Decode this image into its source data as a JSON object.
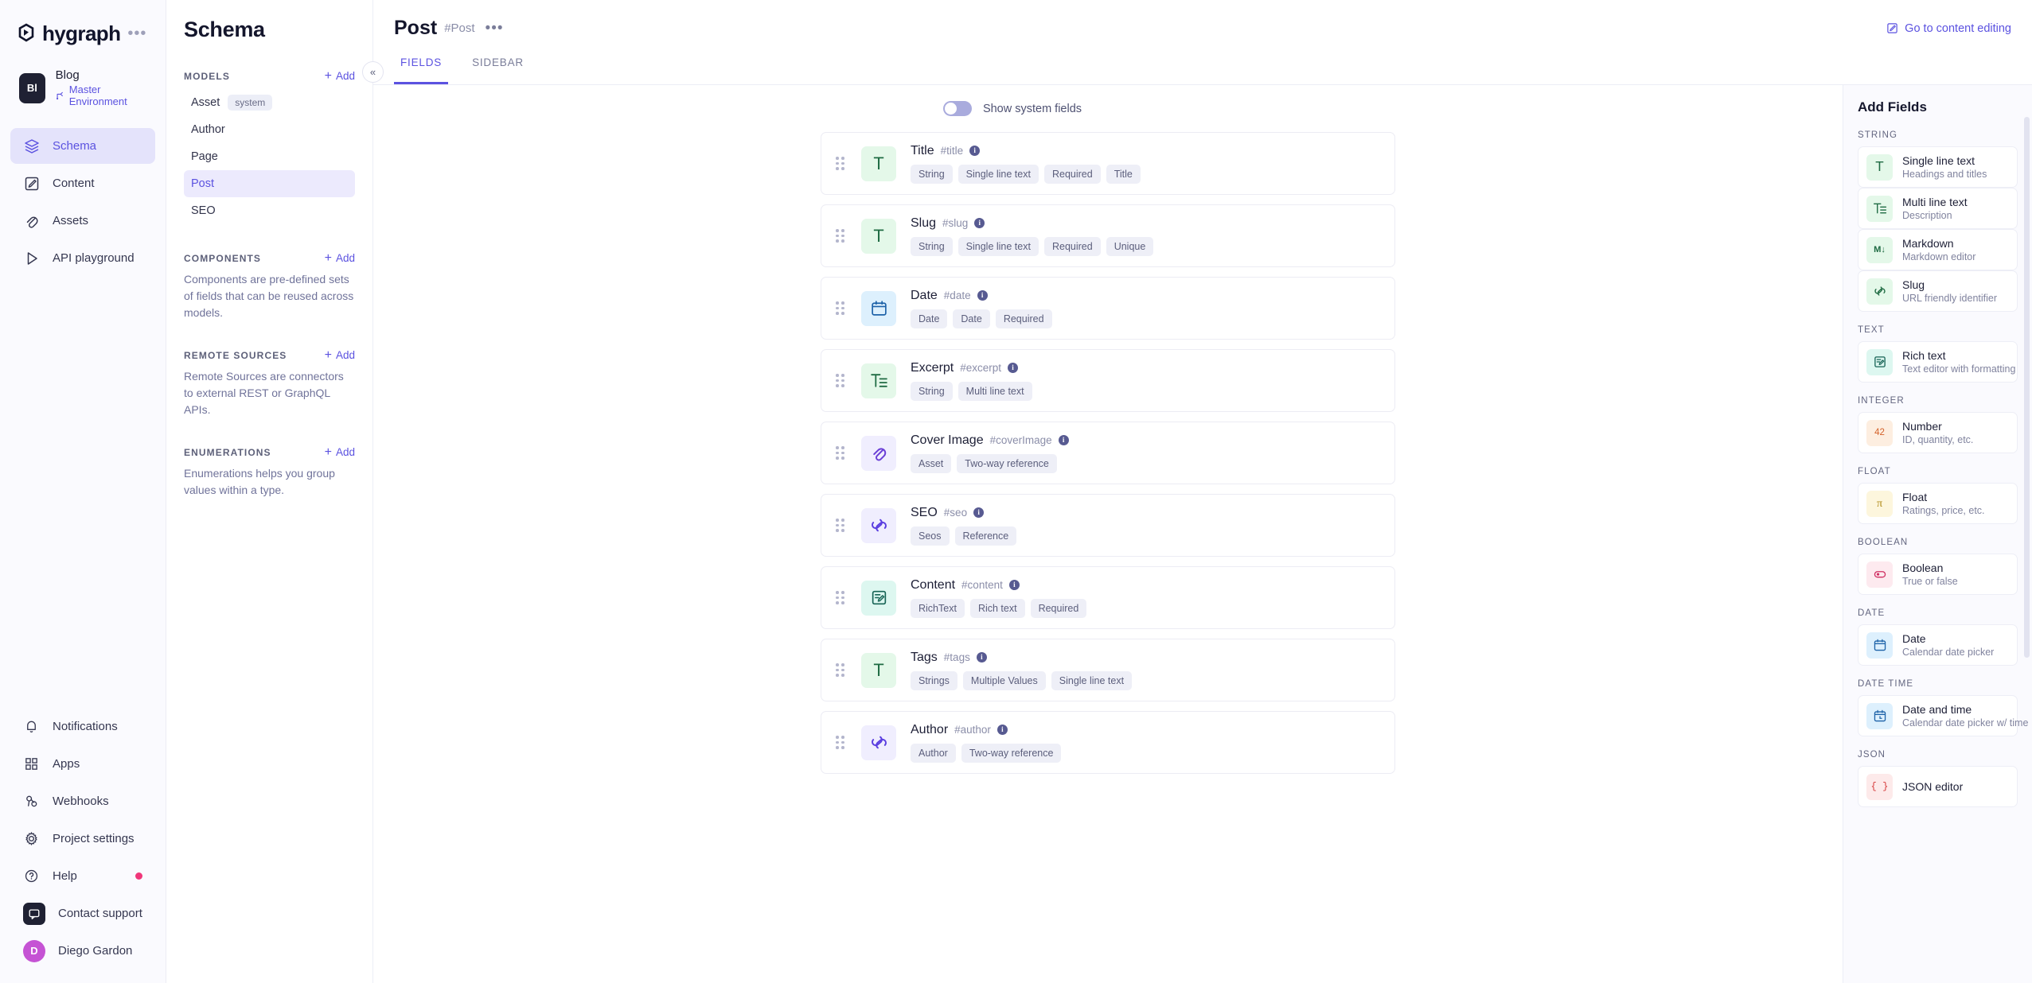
{
  "rail": {
    "brand": {
      "word": "hygraph",
      "dots": "•••",
      "logo_icon": "hygraph-logo-icon"
    },
    "project": {
      "badge": "Bl",
      "name": "Blog",
      "environment": "Master Environment"
    },
    "nav_primary": [
      {
        "label": "Schema",
        "icon": "layers-icon",
        "active": true
      },
      {
        "label": "Content",
        "icon": "edit-square-icon",
        "active": false
      },
      {
        "label": "Assets",
        "icon": "paperclip-icon",
        "active": false
      },
      {
        "label": "API playground",
        "icon": "play-icon",
        "active": false
      }
    ],
    "nav_secondary": [
      {
        "label": "Notifications",
        "icon": "bell-icon",
        "badge": false
      },
      {
        "label": "Apps",
        "icon": "grid-icon",
        "badge": false
      },
      {
        "label": "Webhooks",
        "icon": "webhook-icon",
        "badge": false
      },
      {
        "label": "Project settings",
        "icon": "gear-icon",
        "badge": false
      },
      {
        "label": "Help",
        "icon": "question-circle-icon",
        "badge": true
      }
    ],
    "support": {
      "label": "Contact support",
      "icon": "chat-icon"
    },
    "user": {
      "label": "Diego Gardon",
      "initial": "D"
    }
  },
  "schema_panel": {
    "title": "Schema",
    "collapse_icon": "chevron-double-left-icon",
    "sections": [
      {
        "label": "MODELS",
        "add_label": "Add",
        "items": [
          {
            "label": "Asset",
            "tag": "system",
            "active": false
          },
          {
            "label": "Author",
            "tag": "",
            "active": false
          },
          {
            "label": "Page",
            "tag": "",
            "active": false
          },
          {
            "label": "Post",
            "tag": "",
            "active": true
          },
          {
            "label": "SEO",
            "tag": "",
            "active": false
          }
        ],
        "description": ""
      },
      {
        "label": "COMPONENTS",
        "add_label": "Add",
        "items": [],
        "description": "Components are pre-defined sets of fields that can be reused across models."
      },
      {
        "label": "REMOTE SOURCES",
        "add_label": "Add",
        "items": [],
        "description": "Remote Sources are connectors to external REST or GraphQL APIs."
      },
      {
        "label": "ENUMERATIONS",
        "add_label": "Add",
        "items": [],
        "description": "Enumerations helps you group values within a type."
      }
    ]
  },
  "main": {
    "title": "Post",
    "api_id": "#Post",
    "dots": "•••",
    "goto_content_editing": "Go to content editing",
    "goto_icon": "edit-square-icon",
    "tabs": [
      {
        "label": "FIELDS",
        "active": true
      },
      {
        "label": "SIDEBAR",
        "active": false
      }
    ],
    "show_system_fields": {
      "label": "Show system fields",
      "enabled": false
    }
  },
  "fields": [
    {
      "name": "Title",
      "api_id": "#title",
      "icon": "single-line-text-icon",
      "icon_glyph": "T",
      "icon_bg": "#e4f8e9",
      "icon_fg": "#1f6b43",
      "chips": [
        "String",
        "Single line text",
        "Required",
        "Title"
      ]
    },
    {
      "name": "Slug",
      "api_id": "#slug",
      "icon": "single-line-text-icon",
      "icon_glyph": "T",
      "icon_bg": "#e4f8e9",
      "icon_fg": "#1f6b43",
      "chips": [
        "String",
        "Single line text",
        "Required",
        "Unique"
      ]
    },
    {
      "name": "Date",
      "api_id": "#date",
      "icon": "calendar-icon",
      "icon_glyph": "calendar",
      "icon_bg": "#ddf0fd",
      "icon_fg": "#1d62a8",
      "chips": [
        "Date",
        "Date",
        "Required"
      ]
    },
    {
      "name": "Excerpt",
      "api_id": "#excerpt",
      "icon": "multi-line-text-icon",
      "icon_glyph": "multiline",
      "icon_bg": "#e4f8e9",
      "icon_fg": "#1f6b43",
      "chips": [
        "String",
        "Multi line text"
      ]
    },
    {
      "name": "Cover Image",
      "api_id": "#coverImage",
      "icon": "paperclip-icon",
      "icon_glyph": "paperclip",
      "icon_bg": "#f0eefe",
      "icon_fg": "#6a3fd6",
      "chips": [
        "Asset",
        "Two-way reference"
      ]
    },
    {
      "name": "SEO",
      "api_id": "#seo",
      "icon": "reference-link-icon",
      "icon_glyph": "reference",
      "icon_bg": "#f0eefe",
      "icon_fg": "#5b3fe0",
      "chips": [
        "Seos",
        "Reference"
      ]
    },
    {
      "name": "Content",
      "api_id": "#content",
      "icon": "rich-text-icon",
      "icon_glyph": "richtext",
      "icon_bg": "#ddf7f0",
      "icon_fg": "#176456",
      "chips": [
        "RichText",
        "Rich text",
        "Required"
      ]
    },
    {
      "name": "Tags",
      "api_id": "#tags",
      "icon": "single-line-text-icon",
      "icon_glyph": "T",
      "icon_bg": "#e4f8e9",
      "icon_fg": "#1f6b43",
      "chips": [
        "Strings",
        "Multiple Values",
        "Single line text"
      ]
    },
    {
      "name": "Author",
      "api_id": "#author",
      "icon": "reference-link-icon",
      "icon_glyph": "reference",
      "icon_bg": "#f0eefe",
      "icon_fg": "#5b3fe0",
      "chips": [
        "Author",
        "Two-way reference"
      ]
    }
  ],
  "add_fields": {
    "title": "Add Fields",
    "groups": [
      {
        "label": "STRING",
        "items": [
          {
            "name": "Single line text",
            "desc": "Headings and titles",
            "icon": "single-line-text-icon",
            "glyph": "T",
            "bg": "#e4f8e9",
            "fg": "#1f6b43"
          },
          {
            "name": "Multi line text",
            "desc": "Description",
            "icon": "multi-line-text-icon",
            "glyph": "multiline",
            "bg": "#e4f8e9",
            "fg": "#1f6b43"
          },
          {
            "name": "Markdown",
            "desc": "Markdown editor",
            "icon": "markdown-icon",
            "glyph": "MD",
            "bg": "#e4f8e9",
            "fg": "#1f6b43"
          },
          {
            "name": "Slug",
            "desc": "URL friendly identifier",
            "icon": "link-icon",
            "glyph": "link",
            "bg": "#e4f8e9",
            "fg": "#1f6b43"
          }
        ]
      },
      {
        "label": "TEXT",
        "items": [
          {
            "name": "Rich text",
            "desc": "Text editor with formatting",
            "icon": "rich-text-icon",
            "glyph": "richtext",
            "bg": "#ddf7f0",
            "fg": "#176456"
          }
        ]
      },
      {
        "label": "INTEGER",
        "items": [
          {
            "name": "Number",
            "desc": "ID, quantity, etc.",
            "icon": "number-icon",
            "glyph": "42",
            "bg": "#fdeee0",
            "fg": "#d4622a"
          }
        ]
      },
      {
        "label": "FLOAT",
        "items": [
          {
            "name": "Float",
            "desc": "Ratings, price, etc.",
            "icon": "float-pi-icon",
            "glyph": "π",
            "bg": "#fdf6dd",
            "fg": "#b08a17"
          }
        ]
      },
      {
        "label": "BOOLEAN",
        "items": [
          {
            "name": "Boolean",
            "desc": "True or false",
            "icon": "toggle-icon",
            "glyph": "toggle",
            "bg": "#fdeaef",
            "fg": "#cf2f62"
          }
        ]
      },
      {
        "label": "DATE",
        "items": [
          {
            "name": "Date",
            "desc": "Calendar date picker",
            "icon": "calendar-icon",
            "glyph": "calendar",
            "bg": "#ddf0fd",
            "fg": "#1d62a8"
          }
        ]
      },
      {
        "label": "DATE TIME",
        "items": [
          {
            "name": "Date and time",
            "desc": "Calendar date picker w/ time",
            "icon": "calendar-clock-icon",
            "glyph": "calendar-clock",
            "bg": "#ddf0fd",
            "fg": "#1d62a8"
          }
        ]
      },
      {
        "label": "JSON",
        "items": [
          {
            "name": "JSON editor",
            "desc": "",
            "icon": "braces-icon",
            "glyph": "{ }",
            "bg": "#fdeaea",
            "fg": "#d63b3b"
          }
        ]
      }
    ]
  },
  "colors": {
    "accent": "#5b52e0",
    "accent_bg": "#e4e3fb",
    "danger_dot": "#f0367a"
  }
}
